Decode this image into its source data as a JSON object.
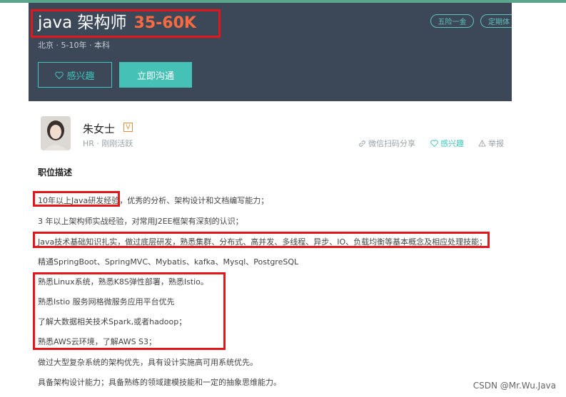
{
  "header": {
    "job_title": "java 架构师",
    "salary": "35-60K",
    "meta": "北京 · 5-10年 · 本科",
    "interest_button": "感兴趣",
    "chat_button": "立即沟通",
    "tags": [
      "五险一金",
      "定期体"
    ],
    "colors": {
      "background": "#3c4757",
      "accent": "#46c1b6",
      "salary": "#fa6a40",
      "highlight_box": "#e3161a"
    }
  },
  "recruiter": {
    "name": "朱女士",
    "badge": "V",
    "meta": "HR · 刚刚活跃",
    "actions": {
      "wechat": "微信扫码分享",
      "interest": "感兴趣",
      "report": "举报"
    }
  },
  "description": {
    "title": "职位描述",
    "lines": [
      "10年以上Java研发经验，优秀的分析、架构设计和文档编写能力；",
      "3 年以上架构师实战经验，对常用J2EE框架有深刻的认识；",
      "Java技术基础知识扎实，做过底层研发，熟悉集群、分布式、高并发、多线程、异步、IO、负载均衡等基本概念及相应处理技能；",
      "精通SpringBoot、SpringMVC、Mybatis、kafka、Mysql、PostgreSQL",
      "熟悉Linux系统，熟悉K8S弹性部署，熟悉Istio。",
      "熟悉Istio 服务网格微服务应用平台优先",
      "了解大数据相关技术Spark,或者hadoop；",
      "熟悉AWS云环境，了解AWS S3；",
      "做过大型复杂系统的架构优先，具有设计实施高可用系统优先。",
      "具备架构设计能力；具备熟练的领域建模技能和一定的抽象思维能力。"
    ]
  },
  "watermark": "CSDN @Mr.Wu.Java"
}
